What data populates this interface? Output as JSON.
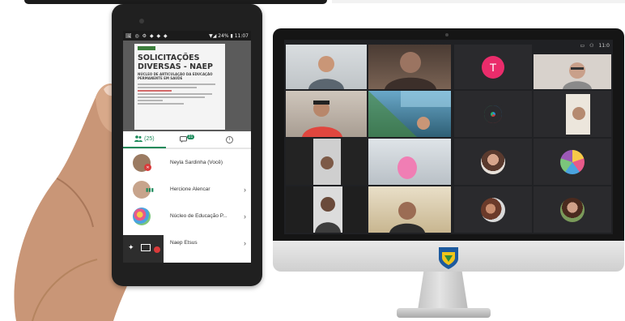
{
  "tablet": {
    "status_bar": {
      "left": "🖼 ◎ ⚙ ◆ ◆ ◆",
      "right": "▼◢ 24% ▮ 11:07"
    },
    "document": {
      "title_line1": "SOLICITAÇÕES",
      "title_line2": "DIVERSAS - NAEP",
      "subtitle": "NÚCLEO DE ARTICULAÇÃO DA EDUCAÇÃO PERMANENTE EM SAÚDE"
    },
    "tabs": {
      "participants_label": "(25)",
      "chat_badge": "21",
      "info_icon": "i"
    },
    "participants": [
      {
        "name": "Neyla Sardinha (Você)",
        "mic": "off"
      },
      {
        "name": "Hercione Alencar",
        "mic": "on"
      },
      {
        "name": "Núcleo de Educação P...",
        "mic": "none"
      },
      {
        "name": "Naep Etsus",
        "mic": "off"
      }
    ],
    "chevron": "›"
  },
  "monitor": {
    "avatar_letter": "T",
    "top_controls": {
      "chat_icon": "chat-icon",
      "people_icon": "people-icon",
      "time": "11:0"
    },
    "colors": {
      "avatar_pink": "#ea2c6b",
      "screen_bg": "#202124"
    }
  }
}
